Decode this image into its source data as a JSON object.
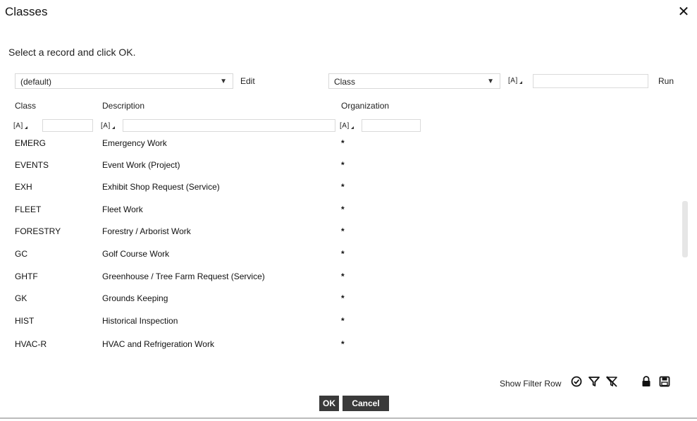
{
  "dialog": {
    "title": "Classes",
    "close_icon": "close-icon"
  },
  "instruction": "Select a record and click OK.",
  "toolbar": {
    "dataspy_value": "(default)",
    "edit_label": "Edit",
    "filter_field_value": "Class",
    "filter_operator": "[A]",
    "filter_value": "",
    "run_label": "Run"
  },
  "columns": [
    "Class",
    "Description",
    "Organization"
  ],
  "filter_row": {
    "operator": "[A]"
  },
  "rows": [
    {
      "class": "EMERG",
      "description": "Emergency Work",
      "organization": "*"
    },
    {
      "class": "EVENTS",
      "description": "Event Work (Project)",
      "organization": "*"
    },
    {
      "class": "EXH",
      "description": "Exhibit Shop Request (Service)",
      "organization": "*"
    },
    {
      "class": "FLEET",
      "description": "Fleet Work",
      "organization": "*"
    },
    {
      "class": "FORESTRY",
      "description": "Forestry / Arborist Work",
      "organization": "*"
    },
    {
      "class": "GC",
      "description": "Golf Course Work",
      "organization": "*"
    },
    {
      "class": "GHTF",
      "description": "Greenhouse / Tree Farm Request (Service)",
      "organization": "*"
    },
    {
      "class": "GK",
      "description": "Grounds Keeping",
      "organization": "*"
    },
    {
      "class": "HIST",
      "description": "Historical Inspection",
      "organization": "*"
    },
    {
      "class": "HVAC-R",
      "description": "HVAC and Refrigeration Work",
      "organization": "*"
    }
  ],
  "footer": {
    "show_filter_row_label": "Show Filter Row",
    "icons": [
      "checkbox-checked-icon",
      "filter-icon",
      "clear-filter-icon",
      "lock-icon",
      "save-icon"
    ]
  },
  "buttons": {
    "ok": "OK",
    "cancel": "Cancel"
  }
}
